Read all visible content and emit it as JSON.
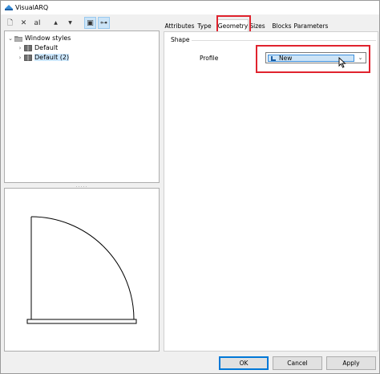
{
  "window": {
    "title": "VisualARQ"
  },
  "toolbar": {
    "buttons": [
      {
        "name": "new-style-icon",
        "glyph": "🗋"
      },
      {
        "name": "delete-icon",
        "glyph": "✕"
      },
      {
        "name": "rename-icon",
        "glyph": "aI"
      },
      {
        "name": "move-up-icon",
        "glyph": "▲"
      },
      {
        "name": "move-down-icon",
        "glyph": "▼"
      },
      {
        "name": "view-preview-icon",
        "glyph": "▣"
      },
      {
        "name": "view-tree-icon",
        "glyph": "⊶"
      }
    ]
  },
  "tree": {
    "root": {
      "label": "Window styles",
      "expand": "⌄"
    },
    "items": [
      {
        "label": "Default",
        "expand": "›"
      },
      {
        "label": "Default (2)",
        "expand": "›",
        "selected": true
      }
    ]
  },
  "splitter": {
    "grip": "....."
  },
  "tabs": [
    "Attributes",
    "Type",
    "Geometry",
    "Sizes",
    "Blocks",
    "Parameters"
  ],
  "active_tab": "Geometry",
  "geometry": {
    "group_label": "Shape",
    "profile_label": "Profile",
    "profile_value": "New",
    "dropdown_arrow": "⌄"
  },
  "footer": {
    "ok": "OK",
    "cancel": "Cancel",
    "apply": "Apply"
  },
  "colors": {
    "highlight": "#e0232e",
    "selection": "#cce4f7",
    "accent": "#0078d7"
  }
}
